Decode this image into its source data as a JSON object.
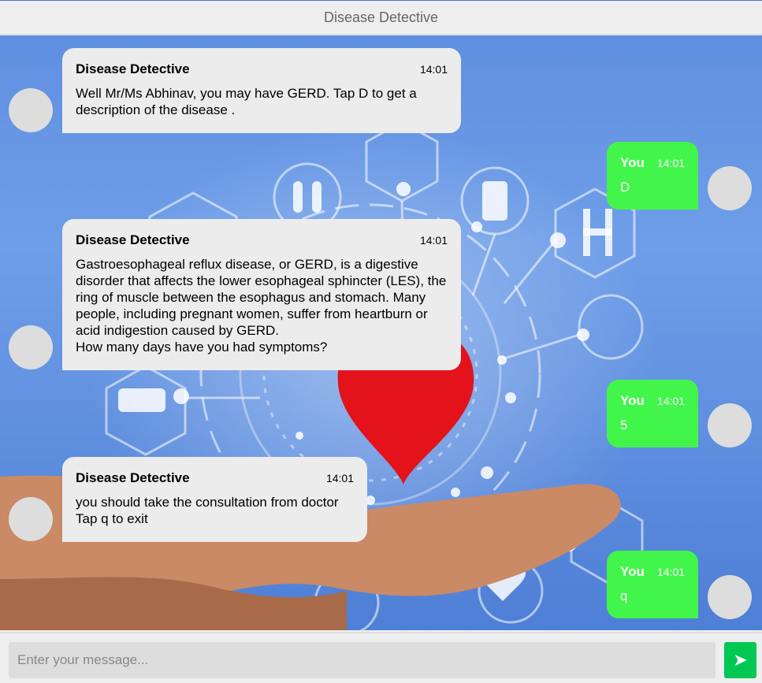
{
  "header": {
    "title": "Disease Detective"
  },
  "messages": [
    {
      "sender": "bot",
      "name": "Disease Detective",
      "time": "14:01",
      "text": "Well Mr/Ms Abhinav, you may have GERD. Tap D to get a description of the disease ."
    },
    {
      "sender": "user",
      "name": "You",
      "time": "14:01",
      "text": "D"
    },
    {
      "sender": "bot",
      "name": "Disease Detective",
      "time": "14:01",
      "text": "Gastroesophageal reflux disease, or GERD, is a digestive disorder that affects the lower esophageal sphincter (LES), the ring of muscle between the esophagus and stomach. Many people, including pregnant women, suffer from heartburn or acid indigestion caused by GERD.\nHow many days have you had symptoms?"
    },
    {
      "sender": "user",
      "name": "You",
      "time": "14:01",
      "text": "5"
    },
    {
      "sender": "bot",
      "name": "Disease Detective",
      "time": "14:01",
      "text": "you should take the consultation from doctor\nTap q to exit"
    },
    {
      "sender": "user",
      "name": "You",
      "time": "14:01",
      "text": "q"
    }
  ],
  "composer": {
    "placeholder": "Enter your message...",
    "send_icon": "send-arrow-icon"
  },
  "colors": {
    "user_bubble": "#42f54b",
    "bot_bubble": "#ececec",
    "send_button": "#00c853"
  }
}
